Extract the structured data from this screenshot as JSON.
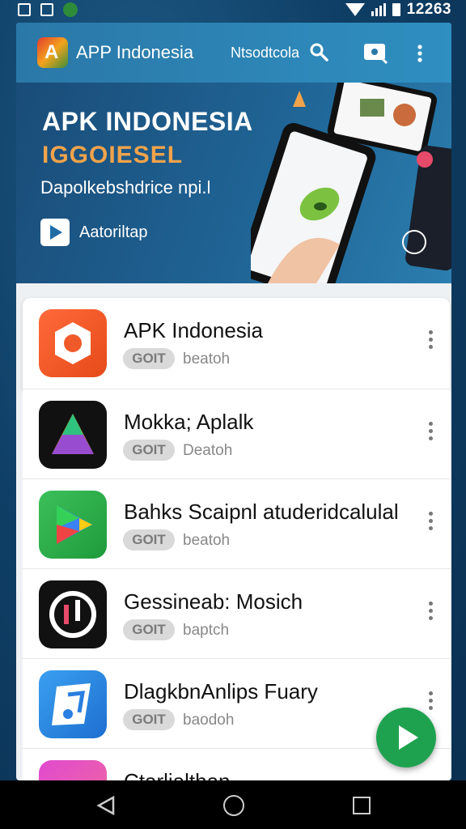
{
  "status": {
    "time": "12263"
  },
  "appbar": {
    "title": "APP Indonesia",
    "search_label": "Ntsodtcola"
  },
  "banner": {
    "title": "APK INDONESIA",
    "subtitle": "IGGOIESEL",
    "description": "Dapolkebshdrice npi.l",
    "button_label": "Aatoriltap"
  },
  "apps": [
    {
      "name": "APK Indonesia",
      "chip": "GOIT",
      "sub": "beatoh"
    },
    {
      "name": "Mokka; Aplalk",
      "chip": "GOIT",
      "sub": "Deatoh"
    },
    {
      "name": "Bahks Scaipnl atuderidcalulal",
      "chip": "GOIT",
      "sub": "beatoh"
    },
    {
      "name": "Gessineab: Mosich",
      "chip": "GOIT",
      "sub": "baptch"
    },
    {
      "name": "DlagkbnAnlips Fuary",
      "chip": "GOIT",
      "sub": "baodoh"
    },
    {
      "name": "Ctarlialthan",
      "chip": "",
      "sub": ""
    }
  ],
  "colors": {
    "appbar": "#2a78a8",
    "accent_orange": "#f1a34b",
    "fab": "#1fa24f"
  }
}
